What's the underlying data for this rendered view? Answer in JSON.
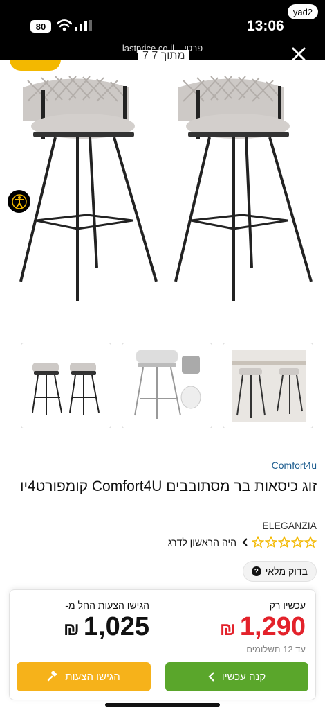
{
  "status_bar": {
    "battery": "80",
    "time": "13:06",
    "badge": "yad2"
  },
  "browser": {
    "url_line": "lastprice.co.il – פרטי"
  },
  "gallery": {
    "partial_title": "7 מתוך 7"
  },
  "product": {
    "brand": "Comfort4u",
    "title": "זוג כיסאות בר מסתובבים Comfort4U קומפורט4יו",
    "collection": "ELEGANZIA",
    "review_link": "היה הראשון לדרג",
    "rating_stars": 0,
    "check_button": "בדוק מלאי"
  },
  "pricing": {
    "now_label": "עכשיו רק",
    "now_price": "1,290",
    "currency": "₪",
    "installments": "עד 12 תשלומים",
    "offer_label": "הגישו הצעות החל מ-",
    "offer_price": "1,025",
    "buy_button": "קנה עכשיו",
    "offer_button": "הגישו הצעות"
  },
  "colors": {
    "brand_link": "#1d5d8f",
    "price_red": "#e3222b",
    "buy_green": "#5aa62b",
    "offer_orange": "#f6b21a",
    "star_yellow": "#f3b800"
  }
}
